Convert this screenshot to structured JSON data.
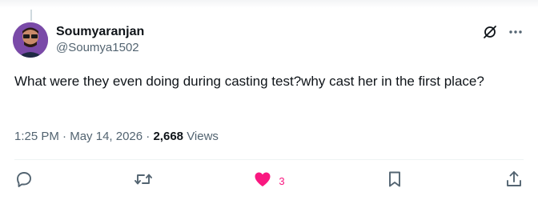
{
  "tweet": {
    "display_name": "Soumyaranjan",
    "handle": "@Soumya1502",
    "text": "What were they even doing during casting test?why cast her in the first place?",
    "time": "1:25 PM",
    "separator1": "·",
    "date": "May 14, 2026",
    "separator2": "·",
    "views_count": "2,668",
    "views_label": "Views"
  },
  "actions": {
    "like_count": "3"
  },
  "colors": {
    "text_primary": "#0f1419",
    "text_secondary": "#536471",
    "like_pink": "#f91880",
    "divider": "#eff3f4"
  },
  "icons": [
    "grok-icon",
    "more-icon",
    "reply-icon",
    "retweet-icon",
    "like-icon",
    "bookmark-icon",
    "share-icon"
  ]
}
